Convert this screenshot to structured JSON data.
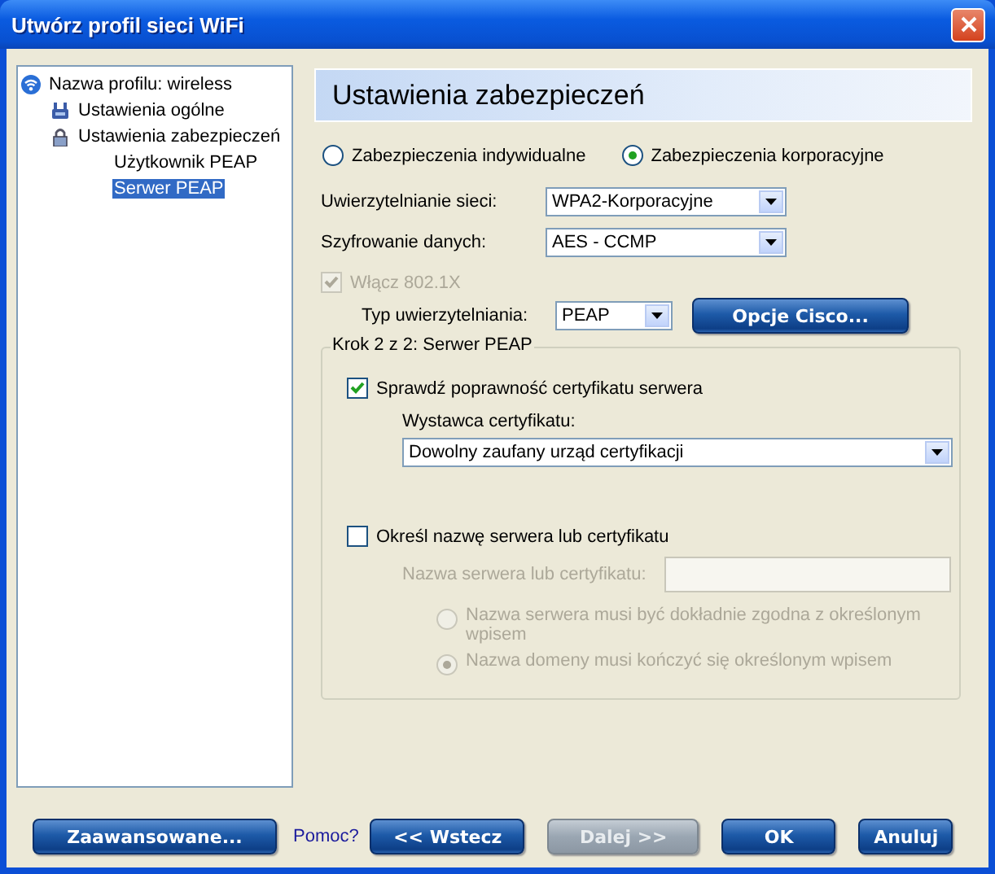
{
  "window": {
    "title": "Utwórz profil sieci WiFi"
  },
  "tree": [
    {
      "label": "Nazwa profilu: wireless",
      "kind": "wifi",
      "selected": false,
      "children": [
        {
          "label": "Ustawienia ogólne",
          "kind": "network",
          "selected": false
        },
        {
          "label": "Ustawienia zabezpieczeń",
          "kind": "lock",
          "selected": false,
          "children": [
            {
              "label": "Użytkownik PEAP",
              "selected": false
            },
            {
              "label": "Serwer PEAP",
              "selected": true
            }
          ]
        }
      ]
    }
  ],
  "panel": {
    "header": "Ustawienia zabezpieczeń",
    "security_modes": [
      {
        "label": "Zabezpieczenia indywidualne",
        "selected": false
      },
      {
        "label": "Zabezpieczenia korporacyjne",
        "selected": true
      }
    ],
    "fields": [
      {
        "label": "Uwierzytelnianie sieci:",
        "value": "WPA2-Korporacyjne"
      },
      {
        "label": "Szyfrowanie danych:",
        "value": "AES - CCMP"
      }
    ],
    "enable_8021x": {
      "label": "Włącz 802.1X",
      "checked": true,
      "disabled": true
    },
    "auth_type": {
      "label": "Typ uwierzytelniania:",
      "value": "PEAP"
    },
    "cisco_button": "Opcje Cisco...",
    "group": {
      "legend": "Krok 2 z 2: Serwer PEAP",
      "validate_cert": {
        "label": "Sprawdź poprawność certyfikatu serwera",
        "checked": true
      },
      "issuer": {
        "label": "Wystawca certyfikatu:",
        "value": "Dowolny zaufany urząd certyfikacji"
      },
      "specify_server": {
        "label": "Określ nazwę serwera lub certyfikatu",
        "checked": false
      },
      "server_name": {
        "label": "Nazwa serwera lub certyfikatu:",
        "disabled": true
      },
      "match_options": [
        {
          "label": "Nazwa serwera musi być dokładnie zgodna z określonym wpisem",
          "selected": false,
          "disabled": true
        },
        {
          "label": "Nazwa domeny musi kończyć się określonym wpisem",
          "selected": true,
          "disabled": true
        }
      ]
    }
  },
  "footer": {
    "advanced_button": {
      "label": "Zaawansowane...",
      "disabled": false
    },
    "help_link": "Pomoc?",
    "buttons": [
      {
        "label": "<< Wstecz",
        "disabled": false
      },
      {
        "label": "Dalej >>",
        "disabled": true
      },
      {
        "label": "OK",
        "disabled": false
      },
      {
        "label": "Anuluj",
        "disabled": false
      }
    ]
  }
}
